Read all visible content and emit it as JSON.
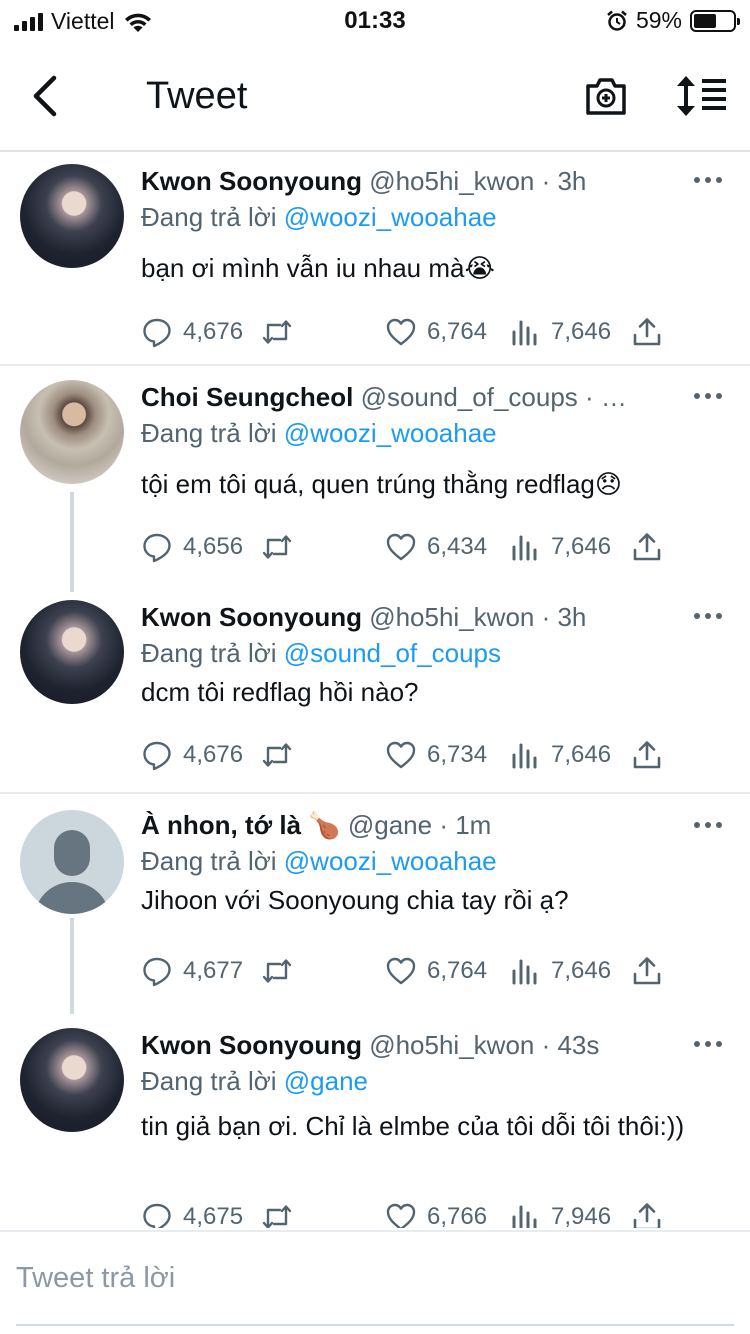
{
  "status_bar": {
    "carrier": "Viettel",
    "time": "01:33",
    "battery_percent": "59%",
    "battery_level": 0.59,
    "icons": [
      "signal-icon",
      "wifi-icon",
      "alarm-icon",
      "battery-icon"
    ]
  },
  "nav": {
    "title": "Tweet",
    "icons": [
      "back-icon",
      "camera-add-icon",
      "sort-icon"
    ]
  },
  "tweets": [
    {
      "name": "Kwon Soonyoung",
      "meta": "@ho5hi_kwon · 3h",
      "reply_prefix": "Đang trả lời ",
      "reply_to": "@woozi_wooahae",
      "text": "bạn ơi mình vẫn iu nhau mà😭",
      "replies": "4,676",
      "likes": "6,764",
      "views": "7,646"
    },
    {
      "name": "Choi Seungcheol",
      "meta": "@sound_of_coups · …",
      "reply_prefix": "Đang trả lời ",
      "reply_to": "@woozi_wooahae",
      "text": "tội em tôi quá, quen trúng thằng redflag😞",
      "replies": "4,656",
      "likes": "6,434",
      "views": "7,646"
    },
    {
      "name": "Kwon Soonyoung",
      "meta": "@ho5hi_kwon · 3h",
      "reply_prefix": "Đang trả lời ",
      "reply_to": "@sound_of_coups",
      "text": "dcm tôi redflag hồi nào?",
      "replies": "4,676",
      "likes": "6,734",
      "views": "7,646"
    },
    {
      "name": "À nhon, tớ là 🍗",
      "meta": "@gane · 1m",
      "reply_prefix": "Đang trả lời ",
      "reply_to": "@woozi_wooahae",
      "text": "Jihoon với Soonyoung chia tay rồi ạ?",
      "replies": "4,677",
      "likes": "6,764",
      "views": "7,646"
    },
    {
      "name": "Kwon Soonyoung",
      "meta": "@ho5hi_kwon · 43s",
      "reply_prefix": "Đang trả lời ",
      "reply_to": "@gane",
      "text": "tin giả bạn ơi. Chỉ là elmbe của tôi dỗi tôi thôi:))",
      "replies": "4,675",
      "likes": "6,766",
      "views": "7,946"
    }
  ],
  "reply_box": {
    "placeholder": "Tweet trả lời"
  },
  "colors": {
    "accent": "#1d9bf0",
    "secondary_text": "#536471",
    "primary_text": "#0f1419",
    "divider": "#e6ecf0"
  }
}
